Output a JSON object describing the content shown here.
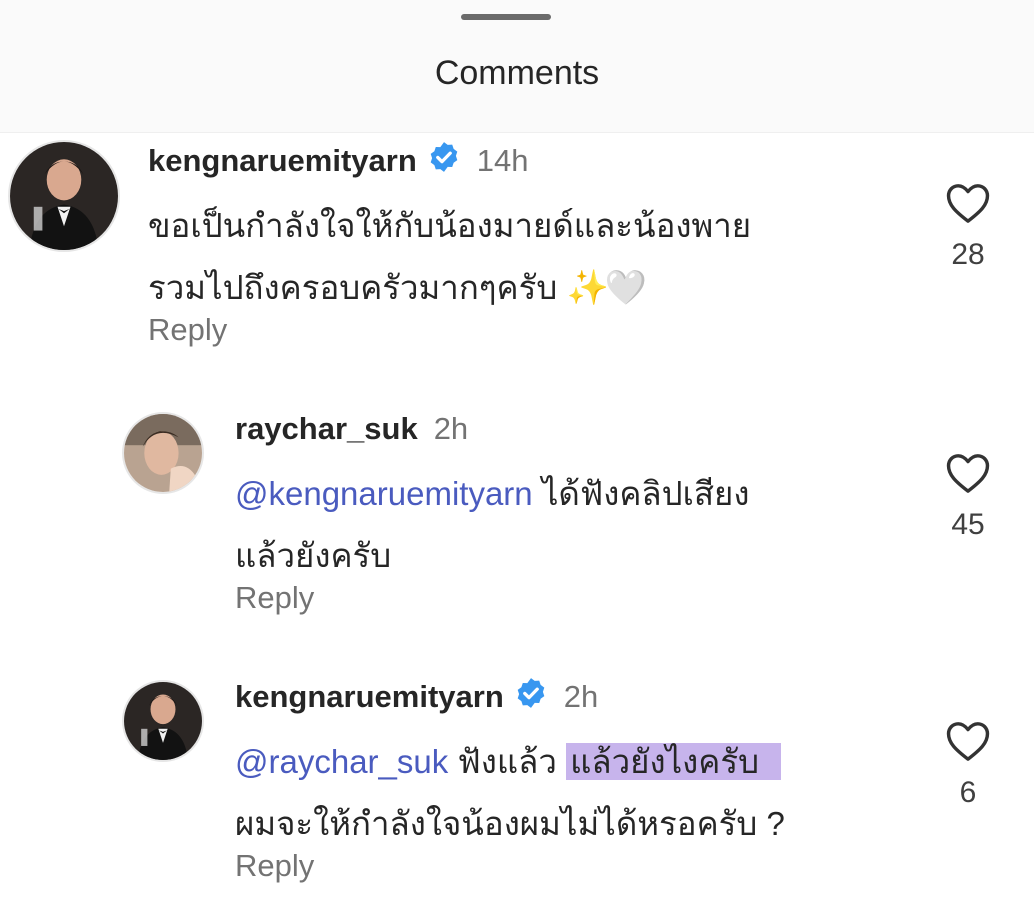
{
  "sheet": {
    "title": "Comments"
  },
  "comments": [
    {
      "username": "kengnaruemityarn",
      "verified": true,
      "time": "14h",
      "lines": [
        "ขอเป็นกำลังใจให้กับน้องมายด์และน้องพาย",
        "รวมไปถึงครอบครัวมากๆครับ"
      ],
      "emoji": "✨🤍",
      "reply_label": "Reply",
      "likes": "28"
    },
    {
      "username": "raychar_suk",
      "verified": false,
      "time": "2h",
      "mention": "@kengnaruemityarn",
      "line1_rest": " ได้ฟังคลิปเสียง",
      "line2": "แล้วยังครับ",
      "reply_label": "Reply",
      "likes": "45"
    },
    {
      "username": "kengnaruemityarn",
      "verified": true,
      "time": "2h",
      "mention": "@raychar_suk",
      "line1_plain": " ฟังแล้ว ",
      "line1_highlight": "แล้วยังไงครับ",
      "line2": "ผมจะให้กำลังใจน้องผมไม่ได้หรอครับ ?",
      "reply_label": "Reply",
      "likes": "6"
    }
  ],
  "colors": {
    "verified_badge": "#3897f0",
    "mention": "#4a5bbf",
    "highlight": "#c7b4ec",
    "muted": "#737373"
  },
  "icons": [
    "verified-badge-icon",
    "heart-outline-icon",
    "sparkles-emoji",
    "white-heart-emoji"
  ]
}
